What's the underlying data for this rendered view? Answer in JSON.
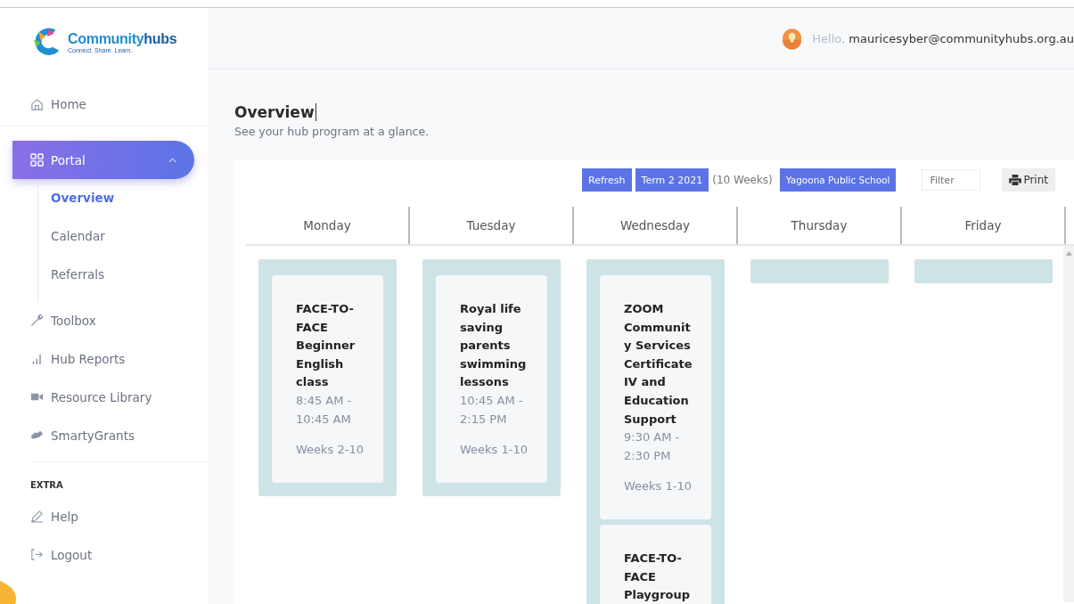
{
  "logo": {
    "name_a": "Community",
    "name_b": "hubs",
    "tagline": "Connect. Share. Learn."
  },
  "header": {
    "greeting": "Hello,",
    "user": "mauricesyber@communityhubs.org.au"
  },
  "sidebar": {
    "items": [
      {
        "kind": "link",
        "label": "Home"
      },
      {
        "kind": "group",
        "label": "Portal",
        "selected": true,
        "expanded": true,
        "children": [
          {
            "label": "Overview",
            "selected": true
          },
          {
            "label": "Calendar",
            "selected": false
          },
          {
            "label": "Referrals",
            "selected": false
          }
        ]
      },
      {
        "kind": "link",
        "label": "Toolbox"
      },
      {
        "kind": "link",
        "label": "Hub Reports"
      },
      {
        "kind": "link",
        "label": "Resource Library"
      },
      {
        "kind": "link",
        "label": "SmartyGrants"
      },
      {
        "kind": "section",
        "label": "EXTRA"
      },
      {
        "kind": "link",
        "label": "Help"
      },
      {
        "kind": "link",
        "label": "Logout"
      }
    ]
  },
  "page": {
    "title": "Overview",
    "subtitle": "See your hub program at a glance."
  },
  "toolbar": {
    "refresh": "Refresh",
    "term": "Term 2 2021",
    "weeks": "(10 Weeks)",
    "school": "Yagoona Public School",
    "filter_placeholder": "Filter",
    "print": "Print"
  },
  "days": [
    {
      "name": "Monday",
      "events": [
        {
          "title": "FACE-TO-FACE Beginner English class",
          "time": "8:45 AM - 10:45 AM",
          "weeks": "Weeks 2-10"
        }
      ]
    },
    {
      "name": "Tuesday",
      "events": [
        {
          "title": "Royal life saving parents swimming lessons",
          "time": "10:45 AM - 2:15 PM",
          "weeks": "Weeks 1-10"
        }
      ]
    },
    {
      "name": "Wednesday",
      "events": [
        {
          "title": "ZOOM Community Services Certificate IV and Education Support",
          "time": "9:30 AM - 2:30 PM",
          "weeks": "Weeks 1-10"
        },
        {
          "title": "FACE-TO-FACE Playgroup"
        }
      ]
    },
    {
      "name": "Thursday"
    },
    {
      "name": "Friday"
    }
  ]
}
